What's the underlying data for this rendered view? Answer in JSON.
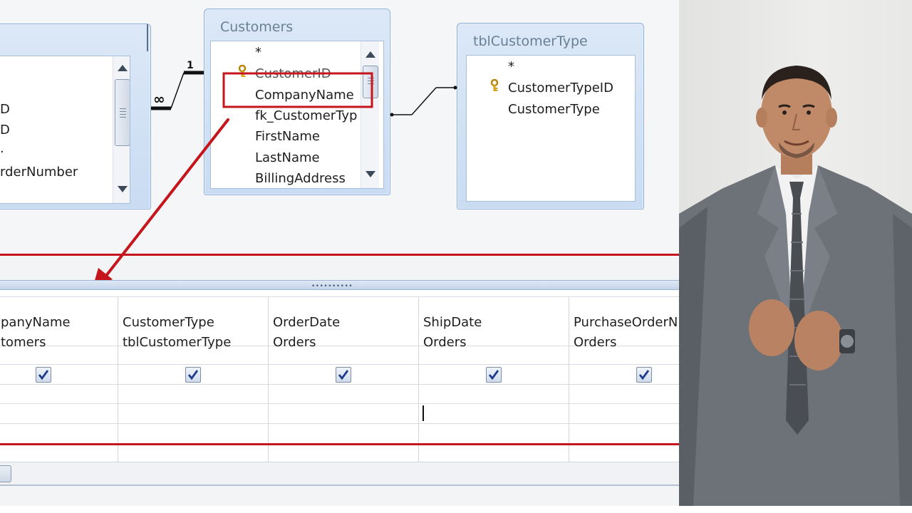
{
  "query_designer": {
    "orders_table": {
      "fields": [
        "D",
        "D",
        ".",
        "rderNumber"
      ]
    },
    "customers_table": {
      "title": "Customers",
      "fields": [
        "*",
        "CustomerID",
        "CompanyName",
        "fk_CustomerTyp",
        "FirstName",
        "LastName",
        "BillingAddress"
      ],
      "highlighted_field": "CompanyName"
    },
    "customer_type_table": {
      "title": "tblCustomerType",
      "fields": [
        "*",
        "CustomerTypeID",
        "CustomerType"
      ]
    },
    "relationship": {
      "one_label": "1",
      "many_label": "∞"
    },
    "grid": {
      "columns": [
        {
          "field": "panyName",
          "table": "tomers",
          "show": true
        },
        {
          "field": "CustomerType",
          "table": "tblCustomerType",
          "show": true
        },
        {
          "field": "OrderDate",
          "table": "Orders",
          "show": true
        },
        {
          "field": "ShipDate",
          "table": "Orders",
          "show": true
        },
        {
          "field": "PurchaseOrderN",
          "table": "Orders",
          "show": true
        }
      ]
    },
    "colors": {
      "highlight_red": "#c4161c",
      "window_blue": "#c9dcf2",
      "key_gold": "#d4a017"
    }
  },
  "photo": {
    "subject": "presenter-in-gray-suit"
  }
}
